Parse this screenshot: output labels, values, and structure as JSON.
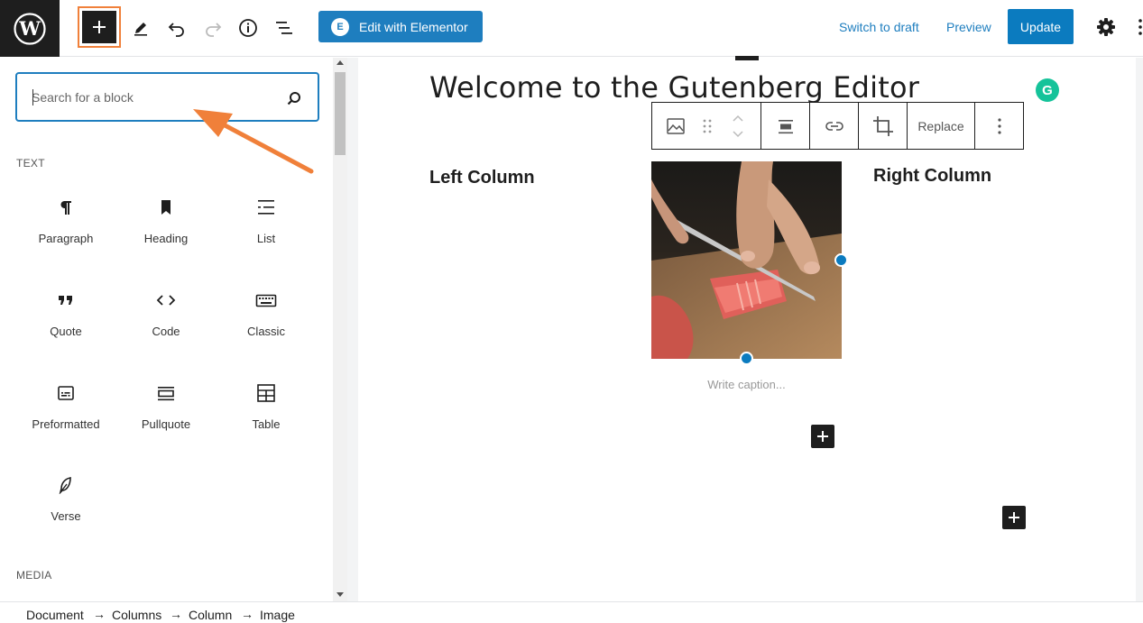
{
  "header": {
    "elementor_label": "Edit with Elementor",
    "elementor_badge": "E",
    "switch_draft": "Switch to draft",
    "preview": "Preview",
    "update": "Update",
    "accent_color": "#1e7ebf",
    "highlight_color": "#f0803a"
  },
  "inserter": {
    "search_placeholder": "Search for a block",
    "categories": {
      "text": "TEXT",
      "media": "MEDIA"
    },
    "blocks": [
      {
        "label": "Paragraph",
        "icon": "paragraph-icon"
      },
      {
        "label": "Heading",
        "icon": "heading-icon"
      },
      {
        "label": "List",
        "icon": "list-icon"
      },
      {
        "label": "Quote",
        "icon": "quote-icon"
      },
      {
        "label": "Code",
        "icon": "code-icon"
      },
      {
        "label": "Classic",
        "icon": "keyboard-icon"
      },
      {
        "label": "Preformatted",
        "icon": "preformatted-icon"
      },
      {
        "label": "Pullquote",
        "icon": "pullquote-icon"
      },
      {
        "label": "Table",
        "icon": "table-icon"
      },
      {
        "label": "Verse",
        "icon": "feather-icon"
      }
    ]
  },
  "editor": {
    "title": "Welcome to the Gutenberg Editor",
    "left_column": "Left Column",
    "right_column": "Right Column",
    "caption_placeholder": "Write caption...",
    "toolbar_replace": "Replace",
    "grammarly_badge": "G"
  },
  "breadcrumb": [
    "Document",
    "Columns",
    "Column",
    "Image"
  ],
  "breadcrumb_separator": "→"
}
